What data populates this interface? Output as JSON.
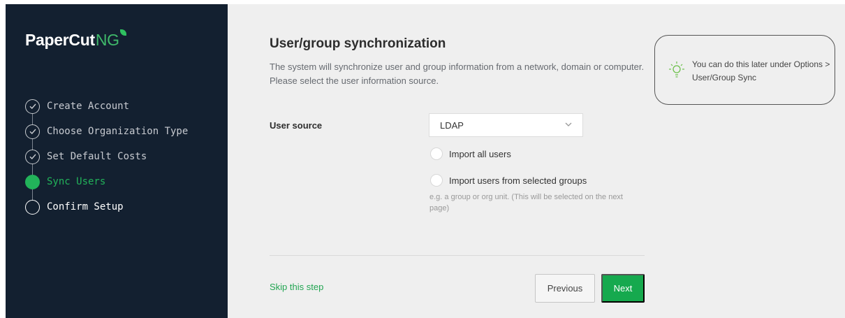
{
  "logo": {
    "main": "PaperCut",
    "accent": "NG"
  },
  "steps": [
    {
      "label": "Create Account",
      "state": "done"
    },
    {
      "label": "Choose Organization Type",
      "state": "done"
    },
    {
      "label": "Set Default Costs",
      "state": "done"
    },
    {
      "label": "Sync Users",
      "state": "active"
    },
    {
      "label": "Confirm Setup",
      "state": "todo"
    }
  ],
  "main": {
    "title": "User/group synchronization",
    "subtitle": "The system will synchronize user and group information from a network, domain or computer. Please select the user information source.",
    "user_source_label": "User source",
    "user_source_value": "LDAP",
    "radio_import_all": "Import all users",
    "radio_import_groups": "Import users from selected groups",
    "hint": "e.g. a group or org unit. (This will be selected on the next page)",
    "skip_label": "Skip this step",
    "previous_label": "Previous",
    "next_label": "Next"
  },
  "tip": {
    "text": "You can do this later under Options > User/Group Sync"
  },
  "colors": {
    "sidebar_bg": "#132030",
    "accent_green": "#22b35a",
    "page_bg": "#efefef"
  }
}
